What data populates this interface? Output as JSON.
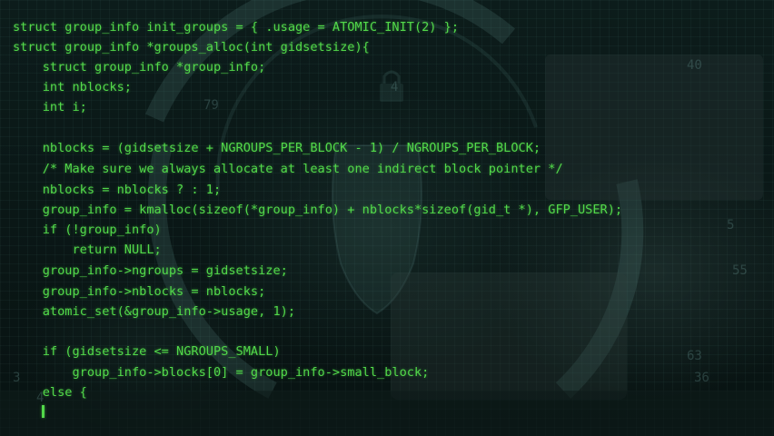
{
  "code_lines": [
    "struct group_info init_groups = { .usage = ATOMIC_INIT(2) };",
    "struct group_info *groups_alloc(int gidsetsize){",
    "    struct group_info *group_info;",
    "    int nblocks;",
    "    int i;",
    "",
    "    nblocks = (gidsetsize + NGROUPS_PER_BLOCK - 1) / NGROUPS_PER_BLOCK;",
    "    /* Make sure we always allocate at least one indirect block pointer */",
    "    nblocks = nblocks ? : 1;",
    "    group_info = kmalloc(sizeof(*group_info) + nblocks*sizeof(gid_t *), GFP_USER);",
    "    if (!group_info)",
    "        return NULL;",
    "    group_info->ngroups = gidsetsize;",
    "    group_info->nblocks = nblocks;",
    "    atomic_set(&group_info->usage, 1);",
    "",
    "    if (gidsetsize <= NGROUPS_SMALL)",
    "        group_info->blocks[0] = group_info->small_block;",
    "    else {"
  ],
  "background_numbers": [
    "40",
    "4",
    "79",
    "5",
    "55",
    "63",
    "36",
    "3",
    "4"
  ],
  "colors": {
    "code_text": "#52d94a",
    "background": "#0a1716",
    "overlay_ring": "#6fa6a0"
  }
}
